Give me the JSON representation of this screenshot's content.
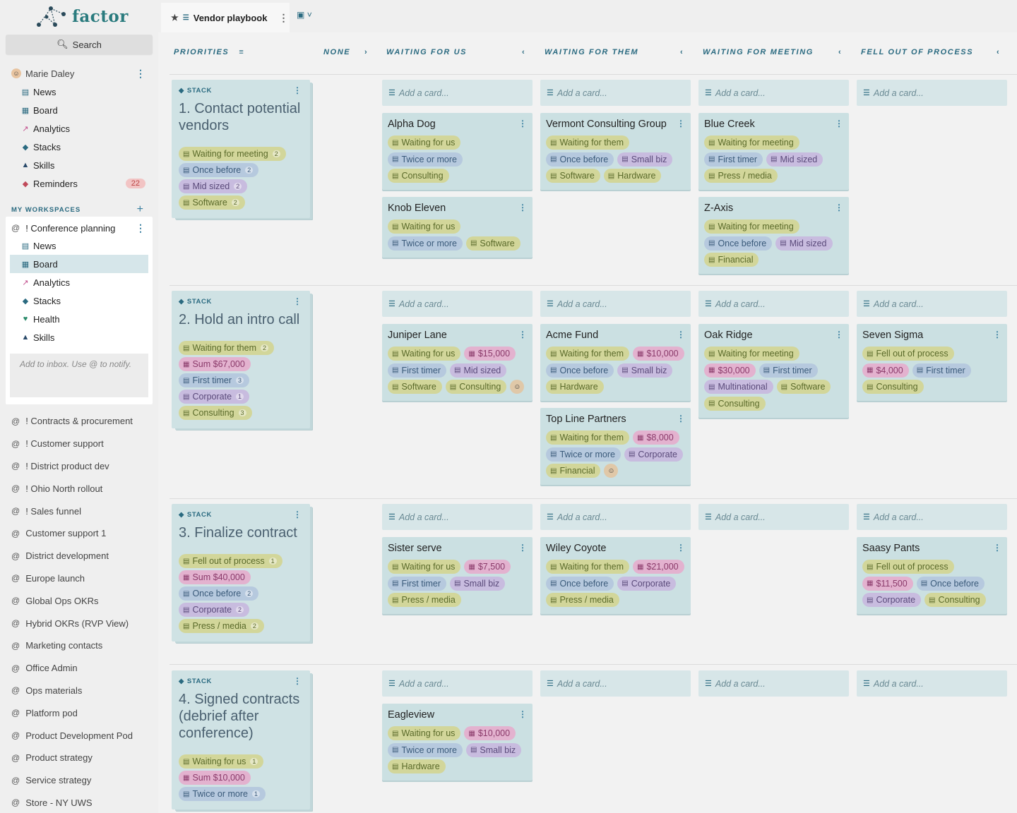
{
  "app": {
    "name": "factor"
  },
  "sidebar": {
    "search_label": "Search",
    "user": {
      "name": "Marie Daley"
    },
    "nav": [
      {
        "label": "News",
        "icon": "news-icon"
      },
      {
        "label": "Board",
        "icon": "board-icon"
      },
      {
        "label": "Analytics",
        "icon": "analytics-icon"
      },
      {
        "label": "Stacks",
        "icon": "stacks-icon"
      },
      {
        "label": "Skills",
        "icon": "skills-icon"
      },
      {
        "label": "Reminders",
        "icon": "bell-icon",
        "badge": "22"
      }
    ],
    "workspaces_label": "MY WORKSPACES",
    "active_workspace": {
      "name": "! Conference planning",
      "nav": [
        {
          "label": "News"
        },
        {
          "label": "Board"
        },
        {
          "label": "Analytics"
        },
        {
          "label": "Stacks"
        },
        {
          "label": "Health"
        },
        {
          "label": "Skills"
        }
      ],
      "inbox_placeholder": "Add to inbox. Use @ to notify."
    },
    "workspaces": [
      "! Contracts & procurement",
      "! Customer support",
      "! District product dev",
      "! Ohio North rollout",
      "! Sales funnel",
      "Customer support 1",
      "District development",
      "Europe launch",
      "Global Ops OKRs",
      "Hybrid OKRs (RVP View)",
      "Marketing contacts",
      "Office Admin",
      "Ops materials",
      "Platform pod",
      "Product Development Pod",
      "Product strategy",
      "Service strategy",
      "Store - NY UWS"
    ]
  },
  "tab": {
    "title": "Vendor playbook"
  },
  "columns": {
    "priorities": "PRIORITIES",
    "none": "NONE",
    "waiting_us": "WAITING FOR US",
    "waiting_them": "WAITING FOR THEM",
    "waiting_meeting": "WAITING FOR MEETING",
    "fell_out": "FELL OUT OF PROCESS"
  },
  "add_card": "Add a card...",
  "stack_label": "STACK",
  "rows": [
    {
      "stack": {
        "title": "1. Contact potential vendors",
        "tags": [
          {
            "text": "Waiting for meeting",
            "count": "2",
            "color": "green"
          },
          {
            "text": "Once before",
            "count": "2",
            "color": "blue"
          },
          {
            "text": "Mid sized",
            "count": "2",
            "color": "purple"
          },
          {
            "text": "Software",
            "count": "2",
            "color": "green"
          }
        ]
      },
      "cards": {
        "us": [
          {
            "name": "Alpha Dog",
            "tags": [
              [
                "Waiting for us",
                "green"
              ],
              [
                "Twice or more",
                "blue"
              ],
              [
                "Consulting",
                "green"
              ]
            ]
          },
          {
            "name": "Knob Eleven",
            "tags": [
              [
                "Waiting for us",
                "green"
              ],
              [
                "Twice or more",
                "blue"
              ],
              [
                "Software",
                "green"
              ]
            ]
          }
        ],
        "them": [
          {
            "name": "Vermont Consulting Group",
            "tags": [
              [
                "Waiting for them",
                "green"
              ],
              [
                "Once before",
                "blue"
              ],
              [
                "Small biz",
                "purple"
              ],
              [
                "Software",
                "green"
              ],
              [
                "Hardware",
                "green"
              ]
            ]
          }
        ],
        "meeting": [
          {
            "name": "Blue Creek",
            "tags": [
              [
                "Waiting for meeting",
                "green"
              ],
              [
                "First timer",
                "blue"
              ],
              [
                "Mid sized",
                "purple"
              ],
              [
                "Press / media",
                "green"
              ]
            ]
          },
          {
            "name": "Z-Axis",
            "tags": [
              [
                "Waiting for meeting",
                "green"
              ],
              [
                "Once before",
                "blue"
              ],
              [
                "Mid sized",
                "purple"
              ],
              [
                "Financial",
                "green"
              ]
            ]
          }
        ],
        "fell": []
      }
    },
    {
      "stack": {
        "title": "2. Hold an intro call",
        "tags": [
          {
            "text": "Waiting for them",
            "count": "2",
            "color": "green"
          },
          {
            "text": "Sum $67,000",
            "count": "",
            "color": "pink"
          },
          {
            "text": "First timer",
            "count": "3",
            "color": "blue"
          },
          {
            "text": "Corporate",
            "count": "1",
            "color": "purple"
          },
          {
            "text": "Consulting",
            "count": "3",
            "color": "green"
          }
        ]
      },
      "cards": {
        "us": [
          {
            "name": "Juniper Lane",
            "tags": [
              [
                "Waiting for us",
                "green"
              ],
              [
                "$15,000",
                "pink"
              ],
              [
                "First timer",
                "blue"
              ],
              [
                "Mid sized",
                "purple"
              ],
              [
                "Software",
                "green"
              ],
              [
                "Consulting",
                "green"
              ]
            ],
            "emoji": true
          }
        ],
        "them": [
          {
            "name": "Acme Fund",
            "tags": [
              [
                "Waiting for them",
                "green"
              ],
              [
                "$10,000",
                "pink"
              ],
              [
                "Once before",
                "blue"
              ],
              [
                "Small biz",
                "purple"
              ],
              [
                "Hardware",
                "green"
              ]
            ]
          },
          {
            "name": "Top Line Partners",
            "tags": [
              [
                "Waiting for them",
                "green"
              ],
              [
                "$8,000",
                "pink"
              ],
              [
                "Twice or more",
                "blue"
              ],
              [
                "Corporate",
                "purple"
              ],
              [
                "Financial",
                "green"
              ]
            ],
            "emoji": true
          }
        ],
        "meeting": [
          {
            "name": "Oak Ridge",
            "tags": [
              [
                "Waiting for meeting",
                "green"
              ],
              [
                "$30,000",
                "pink"
              ],
              [
                "First timer",
                "blue"
              ],
              [
                "Multinational",
                "purple"
              ],
              [
                "Software",
                "green"
              ],
              [
                "Consulting",
                "green"
              ]
            ]
          }
        ],
        "fell": [
          {
            "name": "Seven Sigma",
            "tags": [
              [
                "Fell out of process",
                "green"
              ],
              [
                "$4,000",
                "pink"
              ],
              [
                "First timer",
                "blue"
              ],
              [
                "Consulting",
                "green"
              ]
            ]
          }
        ]
      }
    },
    {
      "stack": {
        "title": "3. Finalize contract",
        "tags": [
          {
            "text": "Fell out of process",
            "count": "1",
            "color": "green"
          },
          {
            "text": "Sum $40,000",
            "count": "",
            "color": "pink"
          },
          {
            "text": "Once before",
            "count": "2",
            "color": "blue"
          },
          {
            "text": "Corporate",
            "count": "2",
            "color": "purple"
          },
          {
            "text": "Press / media",
            "count": "2",
            "color": "green"
          }
        ]
      },
      "cards": {
        "us": [
          {
            "name": "Sister serve",
            "tags": [
              [
                "Waiting for us",
                "green"
              ],
              [
                "$7,500",
                "pink"
              ],
              [
                "First timer",
                "blue"
              ],
              [
                "Small biz",
                "purple"
              ],
              [
                "Press / media",
                "green"
              ]
            ]
          }
        ],
        "them": [
          {
            "name": "Wiley Coyote",
            "tags": [
              [
                "Waiting for them",
                "green"
              ],
              [
                "$21,000",
                "pink"
              ],
              [
                "Once before",
                "blue"
              ],
              [
                "Corporate",
                "purple"
              ],
              [
                "Press / media",
                "green"
              ]
            ]
          }
        ],
        "meeting": [],
        "fell": [
          {
            "name": "Saasy Pants",
            "tags": [
              [
                "Fell out of process",
                "green"
              ],
              [
                "$11,500",
                "pink"
              ],
              [
                "Once before",
                "blue"
              ],
              [
                "Corporate",
                "purple"
              ],
              [
                "Consulting",
                "green"
              ]
            ]
          }
        ]
      }
    },
    {
      "stack": {
        "title": "4. Signed contracts (debrief after conference)",
        "tags": [
          {
            "text": "Waiting for us",
            "count": "1",
            "color": "green"
          },
          {
            "text": "Sum $10,000",
            "count": "",
            "color": "pink"
          },
          {
            "text": "Twice or more",
            "count": "1",
            "color": "blue"
          }
        ]
      },
      "cards": {
        "us": [
          {
            "name": "Eagleview",
            "tags": [
              [
                "Waiting for us",
                "green"
              ],
              [
                "$10,000",
                "pink"
              ],
              [
                "Twice or more",
                "blue"
              ],
              [
                "Small biz",
                "purple"
              ],
              [
                "Hardware",
                "green"
              ]
            ]
          }
        ],
        "them": [],
        "meeting": [],
        "fell": []
      }
    }
  ],
  "colors": {
    "accent": "#2a7b7e",
    "stack_bg": "#cfe2e4",
    "card_bg": "#cbe0e2"
  }
}
